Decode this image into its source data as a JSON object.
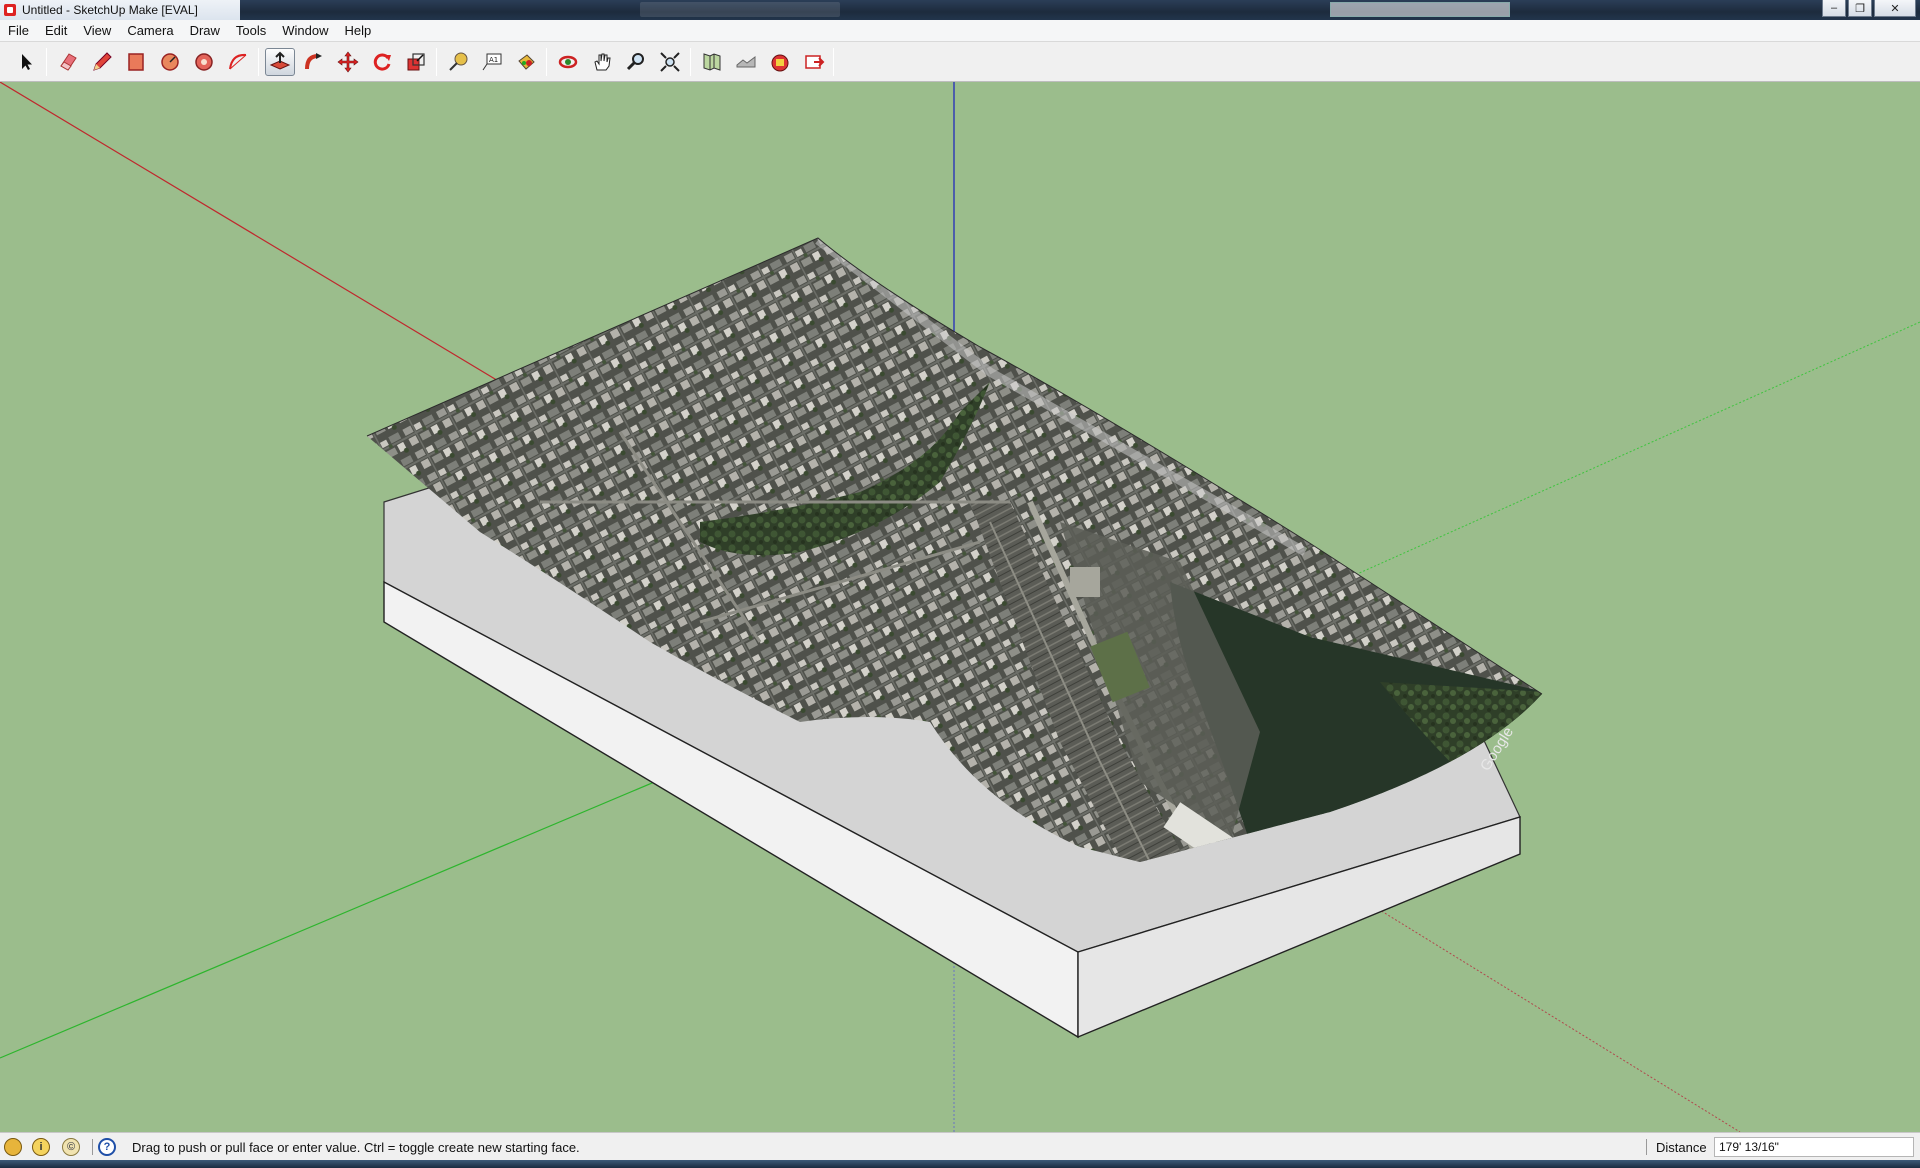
{
  "window": {
    "title": "Untitled - SketchUp Make [EVAL]"
  },
  "menu": {
    "items": [
      "File",
      "Edit",
      "View",
      "Camera",
      "Draw",
      "Tools",
      "Window",
      "Help"
    ]
  },
  "toolbar": {
    "active_tool": "push-pull-tool",
    "tools": [
      "select-tool",
      "eraser-tool",
      "pencil-tool",
      "rectangle-tool",
      "circle-tool",
      "polygon-tool",
      "arc-tool",
      "push-pull-tool",
      "follow-me-tool",
      "move-tool",
      "rotate-tool",
      "scale-tool",
      "tape-measure-tool",
      "text-tool",
      "paint-bucket-tool",
      "orbit-tool",
      "pan-tool",
      "zoom-tool",
      "zoom-extents-tool",
      "add-location-tool",
      "toggle-terrain-tool",
      "get-models-tool",
      "share-model-tool"
    ]
  },
  "viewport": {
    "background_color": "#9bbd8c",
    "axes": {
      "red": "#c0272d",
      "green": "#2db52d",
      "blue": "#2a35b8"
    },
    "terrain_watermark": "Google"
  },
  "status": {
    "message": "Drag to push or pull face or enter value.  Ctrl = toggle create new starting face.",
    "vcb_label": "Distance",
    "vcb_value": "179' 13/16\""
  }
}
